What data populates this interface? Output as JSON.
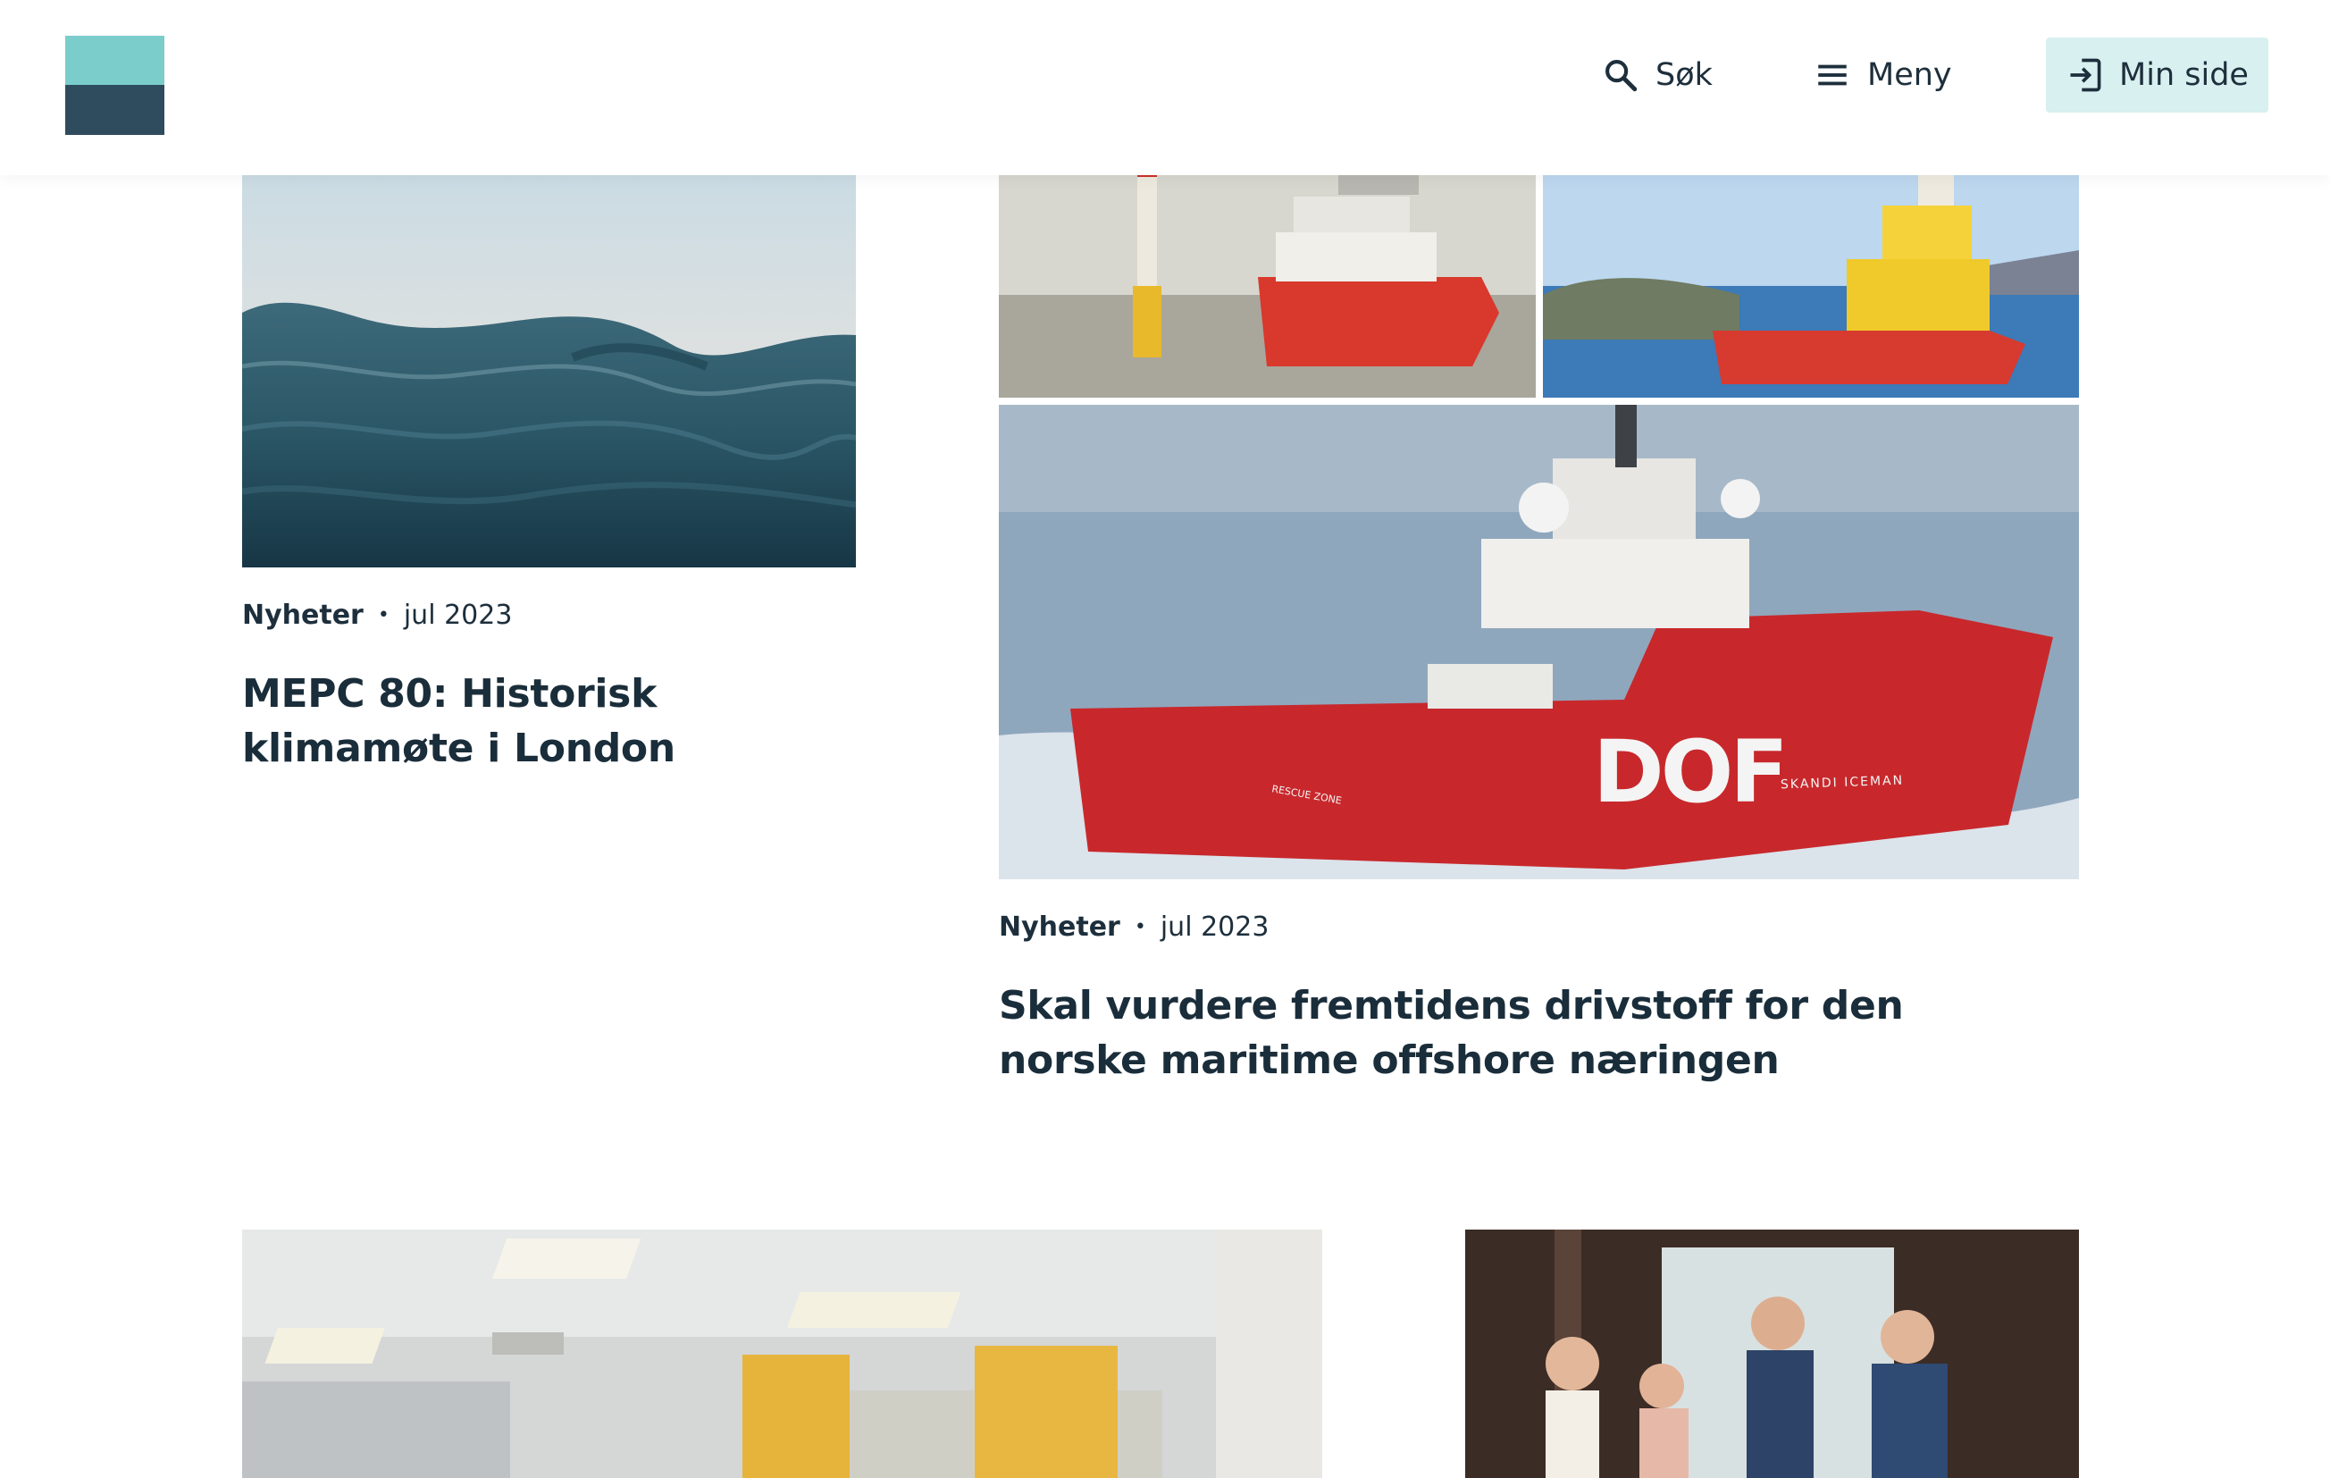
{
  "header": {
    "search_label": "Søk",
    "menu_label": "Meny",
    "minside_label": "Min side"
  },
  "articles": [
    {
      "category": "Nyheter",
      "date": "jul 2023",
      "title": "MEPC 80: Historisk klimamøte i London"
    },
    {
      "category": "Nyheter",
      "date": "jul 2023",
      "title": "Skal vurdere fremtidens drivstoff for den norske maritime offshore næringen"
    }
  ],
  "ship_text": {
    "logo": "DOF",
    "name": "SKANDI ICEMAN",
    "zone": "RESCUE ZONE"
  },
  "icons": {
    "search": "search-icon",
    "menu": "menu-icon",
    "login": "login-icon"
  },
  "colors": {
    "logo_top": "#7bcdcb",
    "logo_bottom": "#2f4b5e",
    "minside_bg": "#d8f0ef",
    "text": "#1c2b36"
  }
}
